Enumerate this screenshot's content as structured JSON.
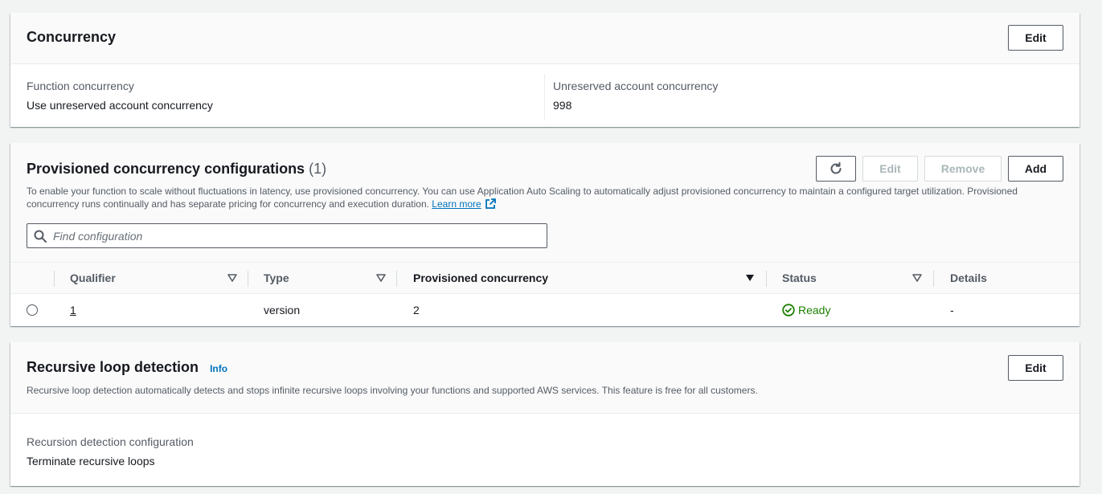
{
  "concurrency": {
    "title": "Concurrency",
    "edit_label": "Edit",
    "function_concurrency_label": "Function concurrency",
    "function_concurrency_value": "Use unreserved account concurrency",
    "unreserved_label": "Unreserved account concurrency",
    "unreserved_value": "998"
  },
  "provisioned": {
    "title": "Provisioned concurrency configurations",
    "count": "(1)",
    "refresh_icon": "refresh-icon",
    "edit_label": "Edit",
    "remove_label": "Remove",
    "add_label": "Add",
    "description": "To enable your function to scale without fluctuations in latency, use provisioned concurrency. You can use Application Auto Scaling to automatically adjust provisioned concurrency to maintain a configured target utilization. Provisioned concurrency runs continually and has separate pricing for concurrency and execution duration.",
    "learn_more": "Learn more",
    "search_placeholder": "Find configuration",
    "columns": {
      "qualifier": "Qualifier",
      "type": "Type",
      "provisioned": "Provisioned concurrency",
      "status": "Status",
      "details": "Details"
    },
    "rows": [
      {
        "qualifier": "1",
        "type": "version",
        "provisioned": "2",
        "status": "Ready",
        "details": "-"
      }
    ]
  },
  "recursive": {
    "title": "Recursive loop detection",
    "info": "Info",
    "edit_label": "Edit",
    "description": "Recursive loop detection automatically detects and stops infinite recursive loops involving your functions and supported AWS services. This feature is free for all customers.",
    "config_label": "Recursion detection configuration",
    "config_value": "Terminate recursive loops"
  },
  "colors": {
    "link": "#0073bb",
    "success": "#1d8102",
    "text": "#16191f",
    "muted": "#545b64"
  }
}
